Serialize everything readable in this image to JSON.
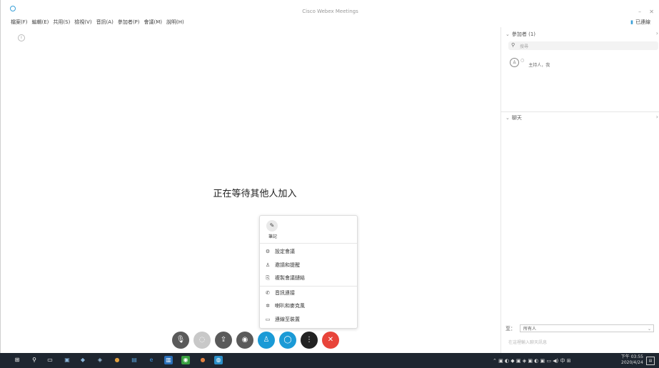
{
  "window": {
    "title": "Cisco Webex Meetings",
    "minimize": "–",
    "close": "✕"
  },
  "menubar": {
    "items": [
      "檔案(F)",
      "編輯(E)",
      "共用(S)",
      "檢視(V)",
      "音訊(A)",
      "參加者(P)",
      "會議(M)",
      "說明(H)"
    ],
    "status": "已連線"
  },
  "stage": {
    "waiting_text": "正在等待其他人加入"
  },
  "participants_panel": {
    "title": "參加者 (1)",
    "search_placeholder": "搜尋",
    "participant_role": "主持人，我"
  },
  "chat_panel": {
    "title": "聊天",
    "to_label": "至：",
    "to_value": "所有人",
    "input_placeholder": "在這裡輸入聊天訊息"
  },
  "more_menu": {
    "notes_label": "筆記",
    "items": [
      {
        "icon": "gear-circle-icon",
        "glyph": "⚙",
        "label": "設定會議"
      },
      {
        "icon": "person-add-icon",
        "glyph": "♙",
        "label": "邀請和提醒"
      },
      {
        "icon": "copy-link-icon",
        "glyph": "⎘",
        "label": "複製會議鏈結"
      },
      {
        "icon": "phone-icon",
        "glyph": "✆",
        "label": "音訊連接"
      },
      {
        "icon": "speaker-settings-icon",
        "glyph": "✲",
        "label": "喇叭和麥克風"
      },
      {
        "icon": "video-system-icon",
        "glyph": "▭",
        "label": "連線至裝置"
      }
    ]
  },
  "controls": [
    {
      "name": "mute-button",
      "icon": "microphone-icon",
      "glyph": "🎙",
      "color": "#5a5a5a"
    },
    {
      "name": "video-button",
      "icon": "video-off-icon",
      "glyph": "◌",
      "color": "#c8c8c8"
    },
    {
      "name": "share-button",
      "icon": "share-icon",
      "glyph": "⇪",
      "color": "#5a5a5a"
    },
    {
      "name": "record-button",
      "icon": "record-icon",
      "glyph": "◉",
      "color": "#5a5a5a"
    },
    {
      "name": "participants-button",
      "icon": "person-icon",
      "glyph": "♙",
      "color": "#1a9ad6"
    },
    {
      "name": "chat-button",
      "icon": "chat-icon",
      "glyph": "◯",
      "color": "#1a9ad6"
    },
    {
      "name": "more-button",
      "icon": "more-icon",
      "glyph": "⋮",
      "color": "#222222"
    },
    {
      "name": "end-meeting-button",
      "icon": "close-icon",
      "glyph": "✕",
      "color": "#e8443a"
    }
  ],
  "taskbar": {
    "time": "下午 03:55",
    "date": "2020/4/24"
  }
}
